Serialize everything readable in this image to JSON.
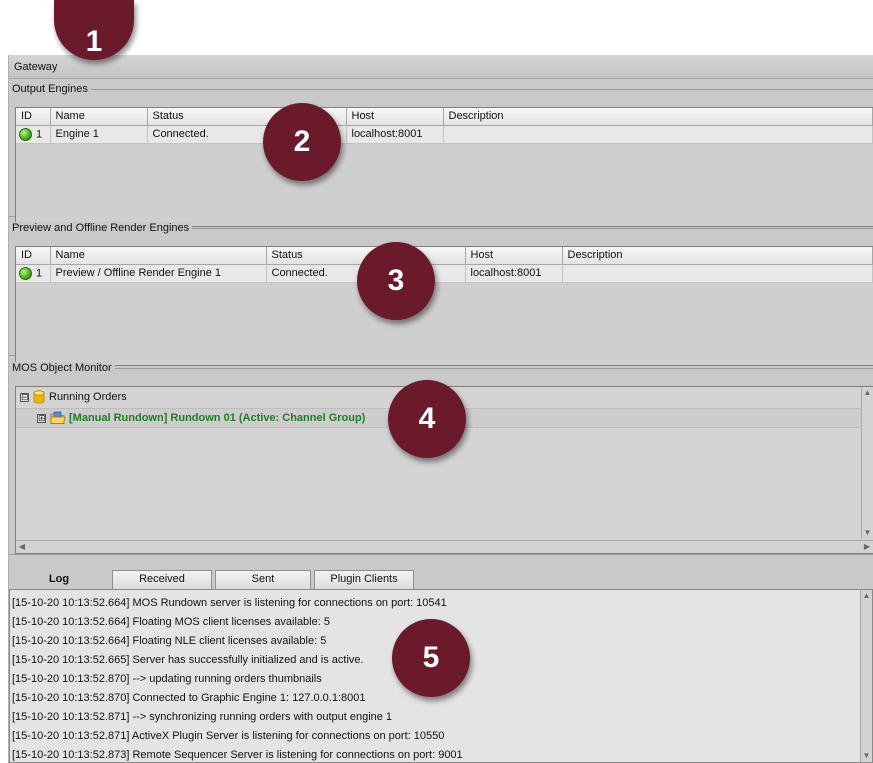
{
  "window": {
    "title": "Gateway"
  },
  "callouts": [
    "1",
    "2",
    "3",
    "4",
    "5"
  ],
  "output_engines": {
    "legend": "Output Engines",
    "columns": [
      "ID",
      "Name",
      "Status",
      "Host",
      "Description"
    ],
    "rows": [
      {
        "id": "1",
        "name": "Engine 1",
        "status": "Connected.",
        "host": "localhost:8001",
        "description": ""
      }
    ]
  },
  "preview_engines": {
    "legend": "Preview and Offline Render Engines",
    "columns": [
      "ID",
      "Name",
      "Status",
      "Host",
      "Description"
    ],
    "rows": [
      {
        "id": "1",
        "name": "Preview / Offline Render Engine 1",
        "status": "Connected.",
        "host": "localhost:8001",
        "description": ""
      }
    ]
  },
  "mos_monitor": {
    "legend": "MOS Object Monitor",
    "root": {
      "label": "Running Orders",
      "expander": "⊟"
    },
    "child": {
      "label": "[Manual Rundown] Rundown 01 (Active: Channel Group)",
      "expander": "⊞"
    }
  },
  "tabs": [
    "Log",
    "Received",
    "Sent",
    "Plugin Clients"
  ],
  "log": [
    "[15-10-20 10:13:52.664] MOS Rundown server is listening for connections on port: 10541",
    "[15-10-20 10:13:52.664] Floating MOS client licenses available: 5",
    "[15-10-20 10:13:52.664] Floating NLE client licenses available: 5",
    "[15-10-20 10:13:52.665] Server has successfully initialized and is active.",
    "[15-10-20 10:13:52.870] --> updating running orders thumbnails",
    "[15-10-20 10:13:52.870] Connected to Graphic Engine 1: 127.0.0.1:8001",
    "[15-10-20 10:13:52.871] --> synchronizing running orders with output engine 1",
    "[15-10-20 10:13:52.871] ActiveX Plugin Server is listening for connections on port: 10550",
    "[15-10-20 10:13:52.873] Remote Sequencer Server is listening for connections on port: 9001"
  ],
  "icons": {
    "status_led": "green-led-icon",
    "database": "database-icon",
    "rundown_folder": "folder-rundown-icon"
  },
  "colors": {
    "callout": "#6b1a2c",
    "rundown_text": "#1d7f1d",
    "status_connected": "#49b21b"
  }
}
